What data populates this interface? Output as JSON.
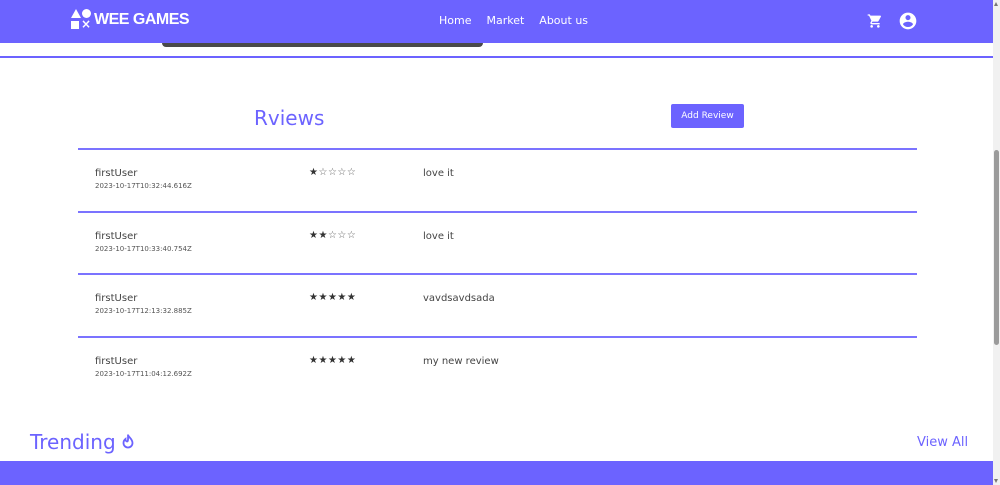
{
  "navbar": {
    "brand": "WEE GAMES",
    "links": [
      "Home",
      "Market",
      "About us"
    ],
    "cart_icon": "cart-icon",
    "account_icon": "account-circle-icon",
    "color": "#6c63ff"
  },
  "reviews": {
    "title": "Rviews",
    "add_button_label": "Add Review",
    "items": [
      {
        "user": "firstUser",
        "date": "2023-10-17T10:32:44.616Z",
        "rating": 1,
        "max": 5,
        "text": "love it"
      },
      {
        "user": "firstUser",
        "date": "2023-10-17T10:33:40.754Z",
        "rating": 2,
        "max": 5,
        "text": "love it"
      },
      {
        "user": "firstUser",
        "date": "2023-10-17T12:13:32.885Z",
        "rating": 5,
        "max": 5,
        "text": "vavdsavdsada"
      },
      {
        "user": "firstUser",
        "date": "2023-10-17T11:04:12.692Z",
        "rating": 5,
        "max": 5,
        "text": "my new review"
      }
    ]
  },
  "trending": {
    "title": "Trending",
    "icon": "fire-icon",
    "view_all_label": "View All"
  }
}
